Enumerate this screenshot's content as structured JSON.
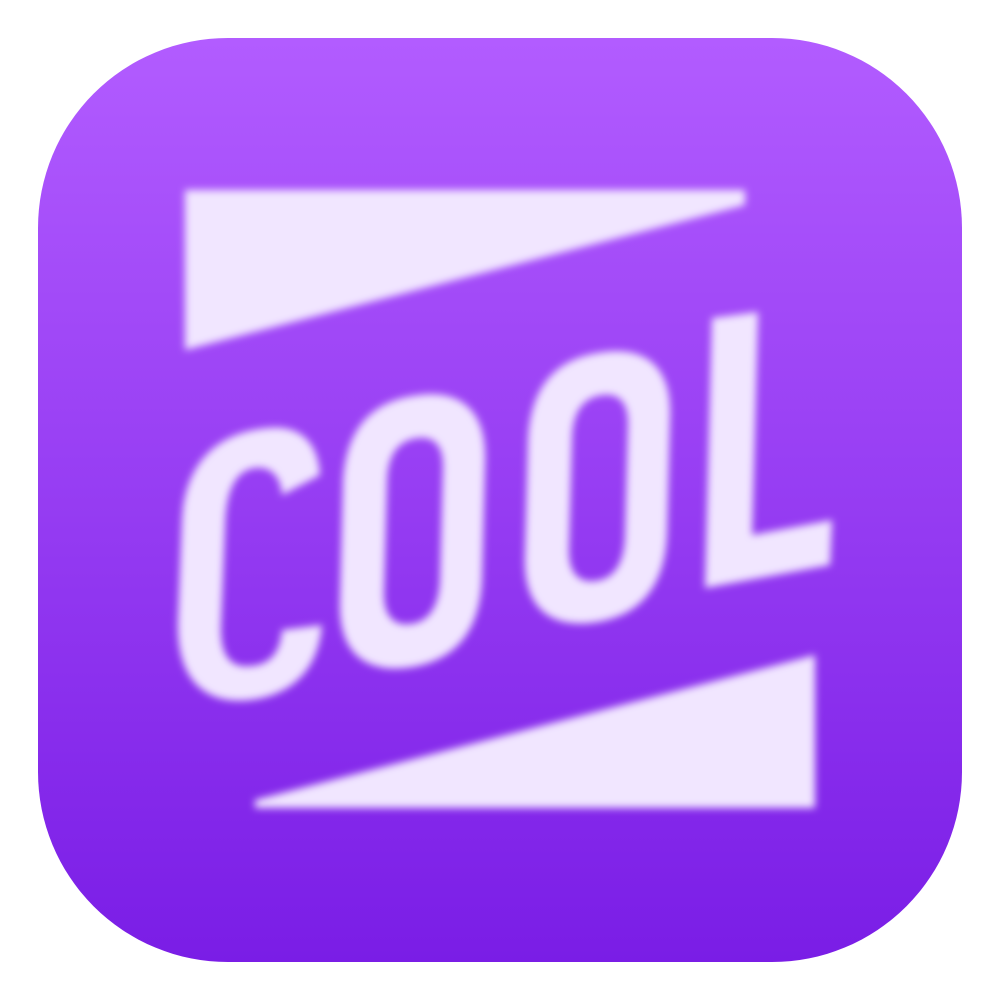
{
  "icon": {
    "name": "cool-button-icon",
    "text": "COOL",
    "colors": {
      "background_top": "#b25cff",
      "background_bottom": "#7a1de6",
      "foreground": "#f1e6ff"
    }
  }
}
